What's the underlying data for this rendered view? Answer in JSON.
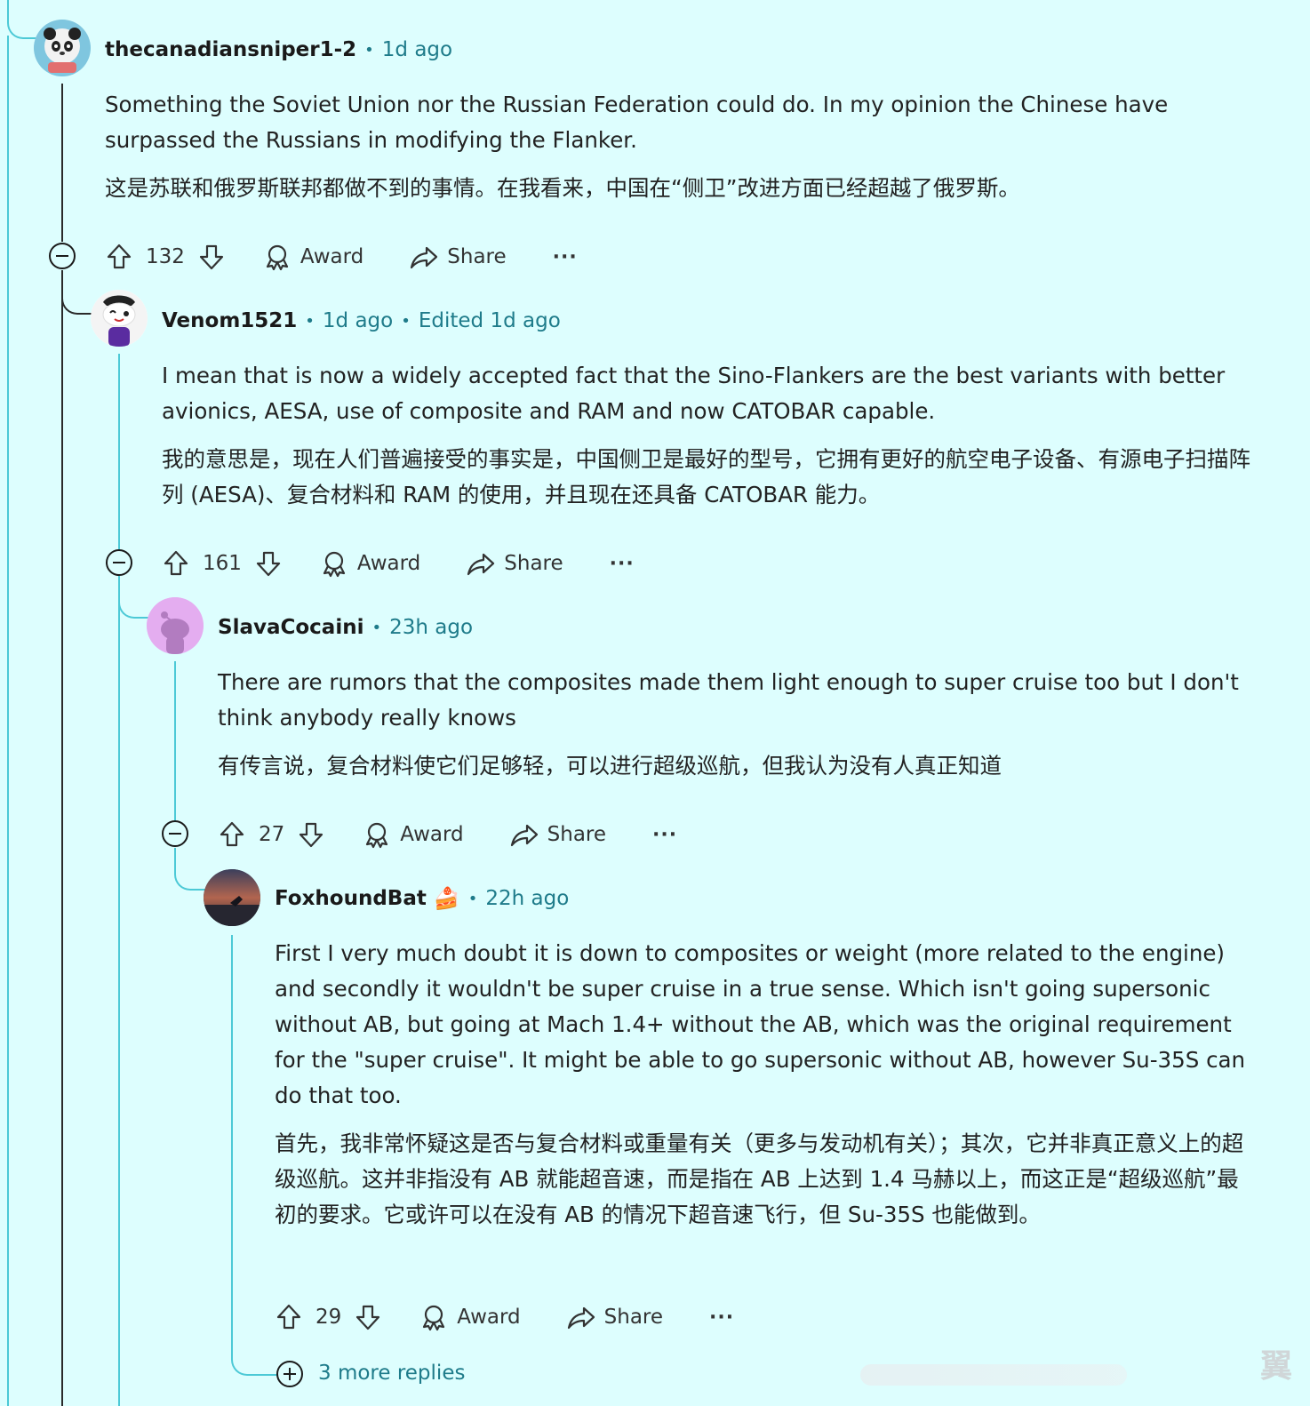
{
  "comments": [
    {
      "username": "thecanadiansniper1-2",
      "time": "1d ago",
      "edited": "",
      "text_en": "Something the Soviet Union nor the Russian Federation could do. In my opinion the Chinese have surpassed the Russians in modifying the Flanker.",
      "text_zh": "这是苏联和俄罗斯联邦都做不到的事情。在我看来，中国在“侧卫”改进方面已经超越了俄罗斯。",
      "score": "132"
    },
    {
      "username": "Venom1521",
      "time": "1d ago",
      "edited": "Edited 1d ago",
      "text_en": "I mean that is now a widely accepted fact that the Sino-Flankers are the best variants with better avionics, AESA, use of composite and RAM and now CATOBAR capable.",
      "text_zh": "我的意思是，现在人们普遍接受的事实是，中国侧卫是最好的型号，它拥有更好的航空电子设备、有源电子扫描阵列 (AESA)、复合材料和 RAM 的使用，并且现在还具备 CATOBAR 能力。",
      "score": "161"
    },
    {
      "username": "SlavaCocaini",
      "time": "23h ago",
      "edited": "",
      "text_en": "There are rumors that the composites made them light enough to super cruise too but I don't think anybody really knows",
      "text_zh": "有传言说，复合材料使它们足够轻，可以进行超级巡航，但我认为没有人真正知道",
      "score": "27"
    },
    {
      "username": "FoxhoundBat",
      "time": "22h ago",
      "edited": "",
      "text_en": "First I very much doubt it is down to composites or weight (more related to the engine) and secondly it wouldn't be super cruise in a true sense. Which isn't going supersonic without AB, but going at Mach 1.4+ without the AB, which was the original requirement for the \"super cruise\". It might be able to go supersonic without AB, however Su-35S can do that too.",
      "text_zh": "首先，我非常怀疑这是否与复合材料或重量有关（更多与发动机有关）；其次，它并非真正意义上的超级巡航。这并非指没有 AB 就能超音速，而是指在 AB 上达到 1.4 马赫以上，而这正是“超级巡航”最初的要求。它或许可以在没有 AB 的情况下超音速飞行，但 Su-35S 也能做到。",
      "score": "29"
    }
  ],
  "labels": {
    "award": "Award",
    "share": "Share",
    "more": "···",
    "dot": "•",
    "more_replies": "3 more replies"
  },
  "watermark": "翼",
  "icons": [
    "upvote-icon",
    "downvote-icon",
    "award-icon",
    "share-icon",
    "collapse-icon",
    "expand-icon",
    "cake-icon"
  ],
  "colors": {
    "background": "#ddfefe",
    "accent": "#1e7b8a",
    "thread_line": "#4cc9d6"
  }
}
